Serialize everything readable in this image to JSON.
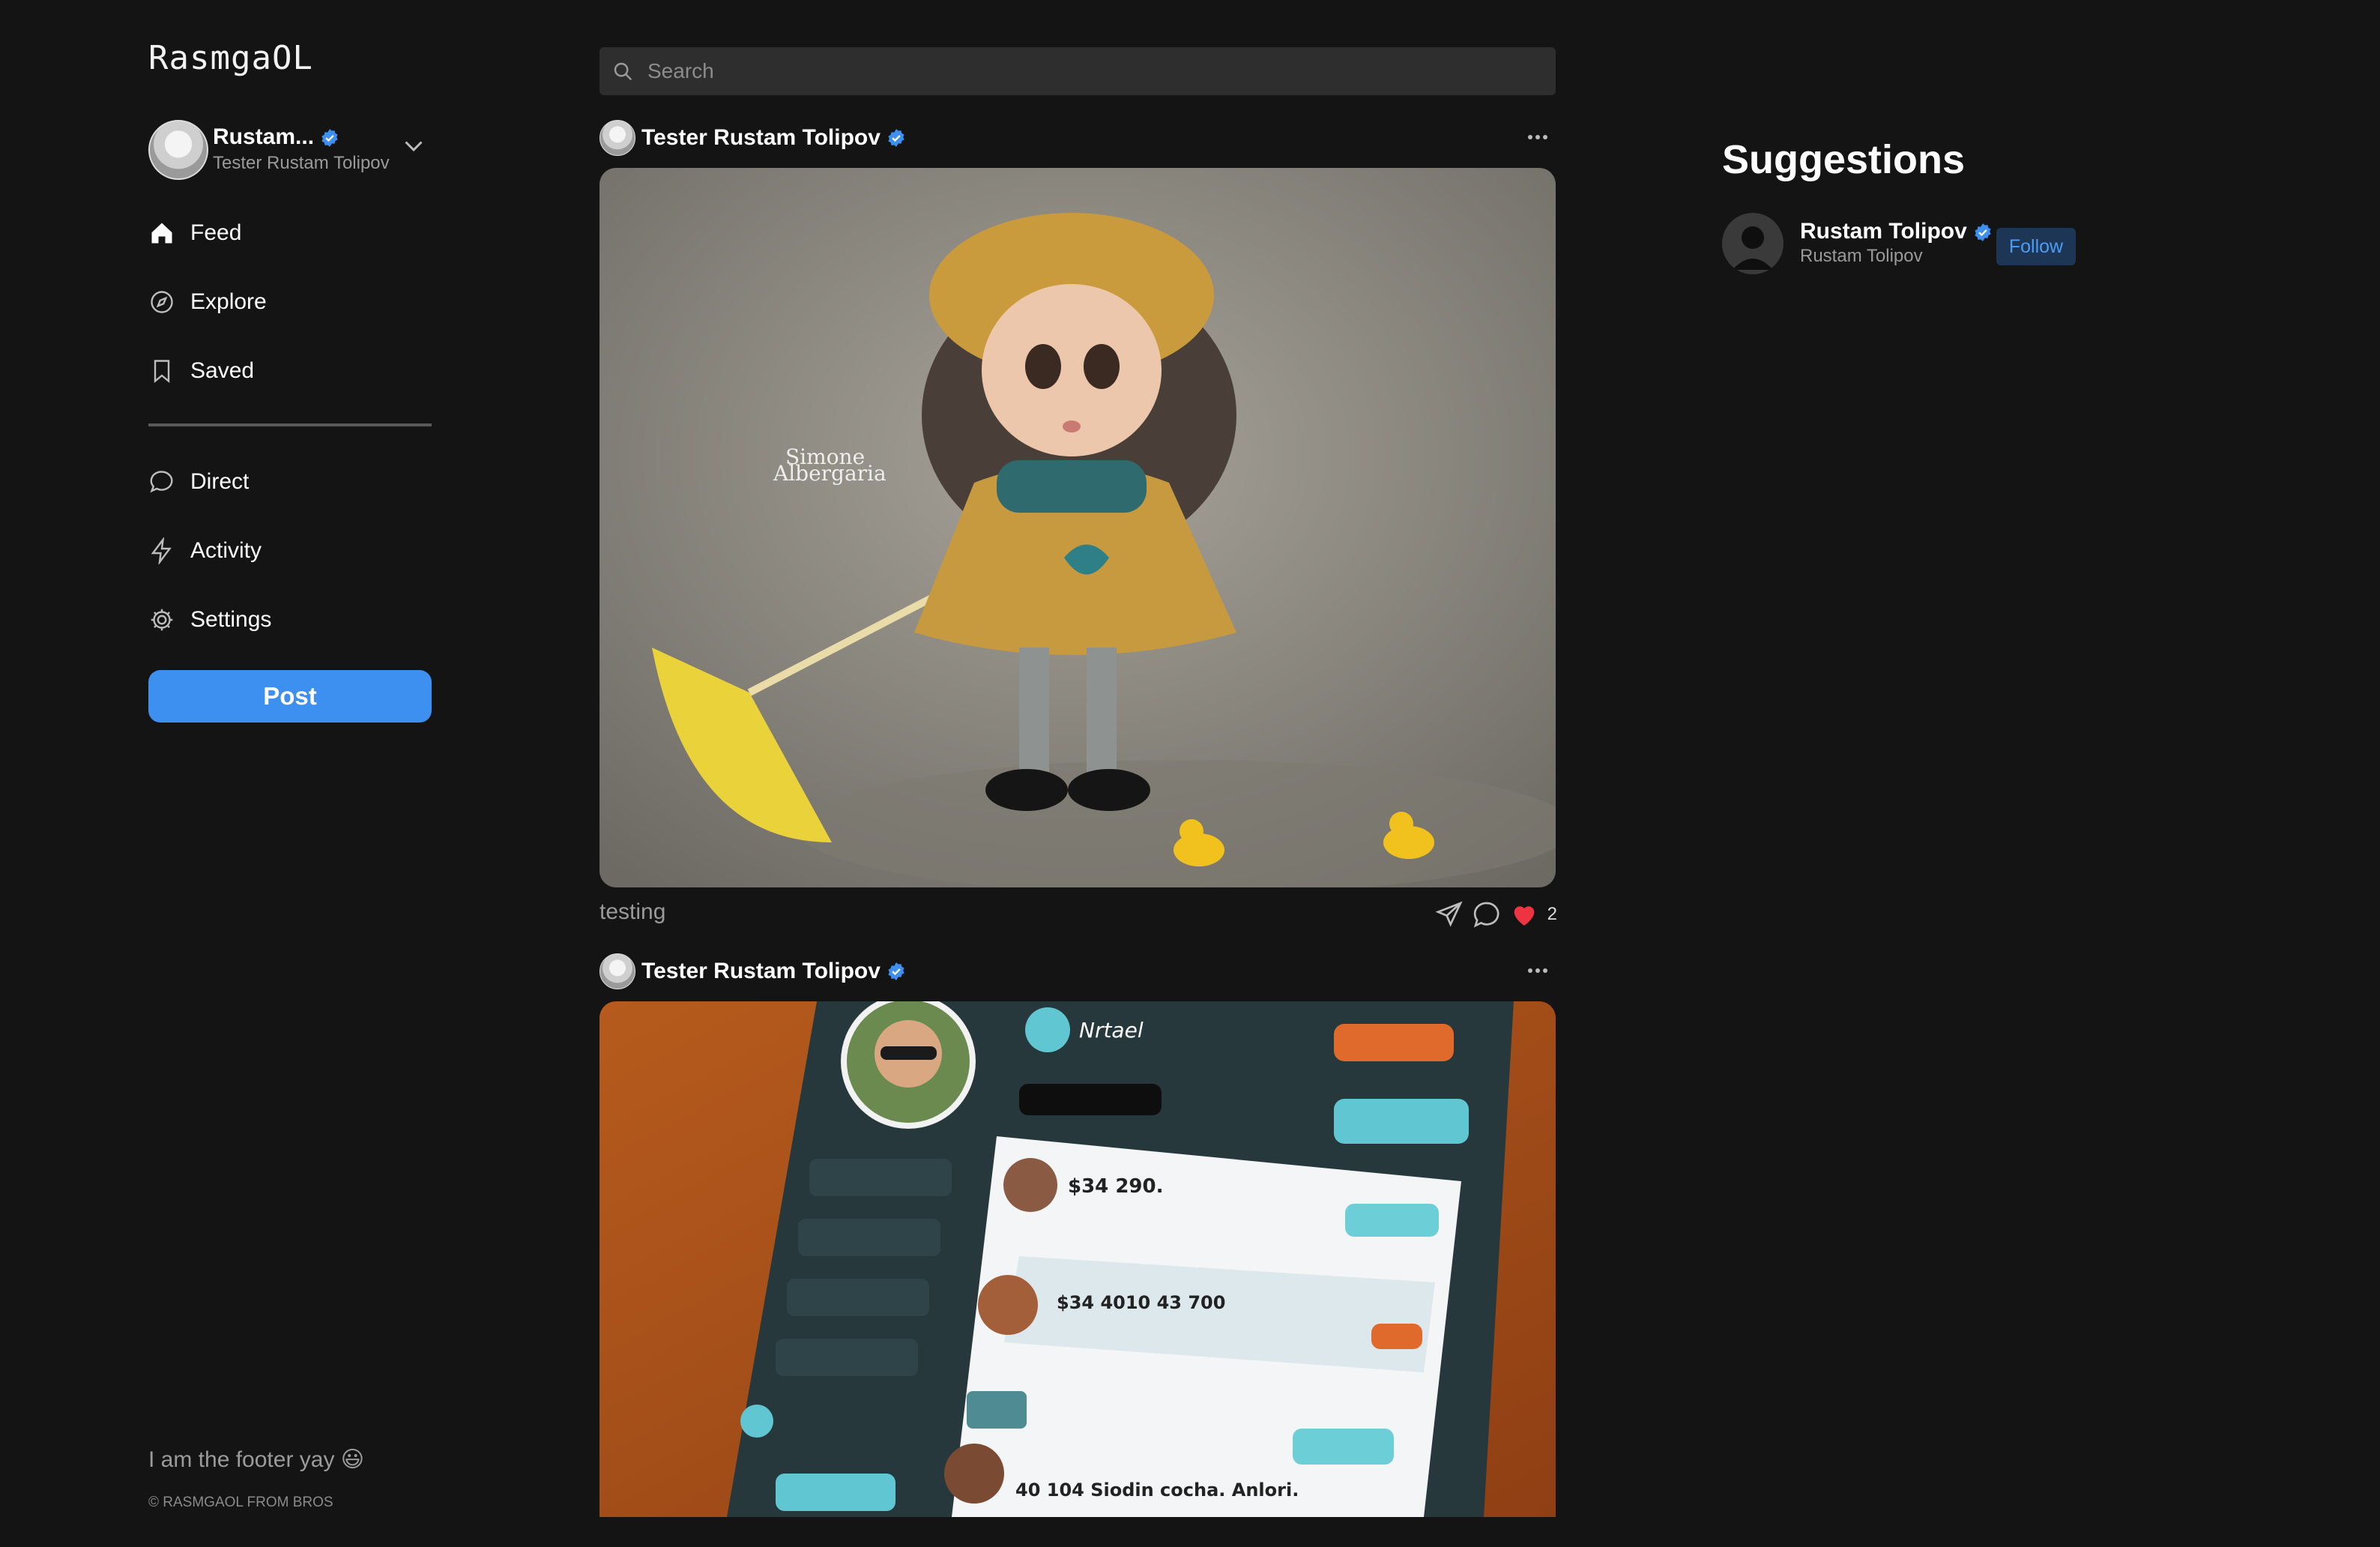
{
  "app": {
    "logo": "RasmgaOL"
  },
  "user": {
    "name": "Rustam...",
    "handle": "Tester Rustam Tolipov",
    "verified": true
  },
  "nav": {
    "primary": [
      {
        "label": "Feed",
        "icon": "home-icon"
      },
      {
        "label": "Explore",
        "icon": "compass-icon"
      },
      {
        "label": "Saved",
        "icon": "bookmark-icon"
      }
    ],
    "secondary": [
      {
        "label": "Direct",
        "icon": "chat-icon"
      },
      {
        "label": "Activity",
        "icon": "lightning-icon"
      },
      {
        "label": "Settings",
        "icon": "gear-icon"
      }
    ],
    "post_button": "Post"
  },
  "search": {
    "placeholder": "Search",
    "value": ""
  },
  "feed": {
    "posts": [
      {
        "author": "Tester Rustam Tolipov",
        "verified": true,
        "image_watermark": "Simone\nAlbergaria",
        "caption": "testing",
        "likes": "2",
        "liked": true
      },
      {
        "author": "Tester Rustam Tolipov",
        "verified": true,
        "image_title": "Nrtael",
        "image_row_1": "$34 290.",
        "image_row_2": "$34 4010 43 700",
        "image_row_3": "40 104 Siodin cocha. Anlori."
      }
    ]
  },
  "suggestions": {
    "title": "Suggestions",
    "items": [
      {
        "name": "Rustam Tolipov",
        "handle": "Rustam Tolipov",
        "verified": true,
        "button": "Follow"
      }
    ]
  },
  "footer": {
    "text": "I am the footer yay 😃",
    "copyright": "© RASMGAOL FROM BROS"
  },
  "colors": {
    "background": "#141414",
    "accent": "#3d8ff0",
    "verified": "#3d8ff0",
    "like": "#ee3440",
    "follow_bg": "#1d3656"
  }
}
